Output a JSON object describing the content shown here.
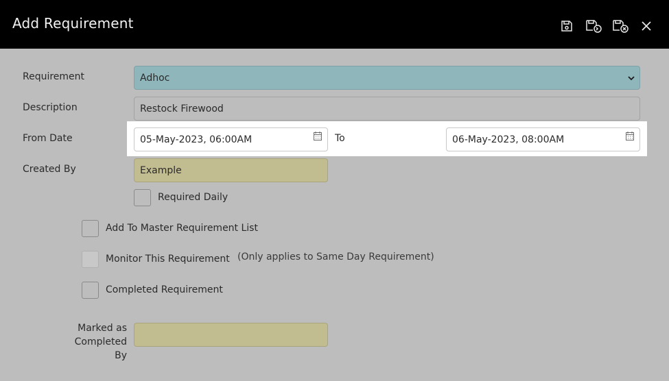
{
  "header": {
    "title": "Add Requirement",
    "buttons": [
      {
        "name": "save-icon"
      },
      {
        "name": "save-and-copy-icon"
      },
      {
        "name": "save-and-close-icon"
      },
      {
        "name": "close-icon"
      }
    ]
  },
  "form": {
    "requirement": {
      "label": "Requirement",
      "value": "Adhoc"
    },
    "description": {
      "label": "Description",
      "value": "Restock Firewood"
    },
    "from_date": {
      "label": "From Date",
      "value": "05-May-2023, 06:00AM"
    },
    "to_date": {
      "label": "To",
      "value": "06-May-2023, 08:00AM"
    },
    "created_by": {
      "label": "Created By",
      "value": "Example"
    },
    "required_daily": {
      "label": "Required Daily",
      "checked": false
    },
    "add_to_master": {
      "label": "Add To Master Requirement List",
      "checked": false
    },
    "monitor": {
      "label": "Monitor This Requirement",
      "checked": false,
      "disabled": true,
      "note": "(Only applies to Same Day Requirement)"
    },
    "completed": {
      "label": "Completed Requirement",
      "checked": false
    },
    "marked_completed_by": {
      "label_line1": "Marked as Completed",
      "label_line2": "By",
      "value": ""
    }
  },
  "colors": {
    "header_bg": "#000000",
    "page_bg": "#bdbdbd",
    "select_bg": "#8fb6bb",
    "readonly_bg": "#c2bd90"
  }
}
